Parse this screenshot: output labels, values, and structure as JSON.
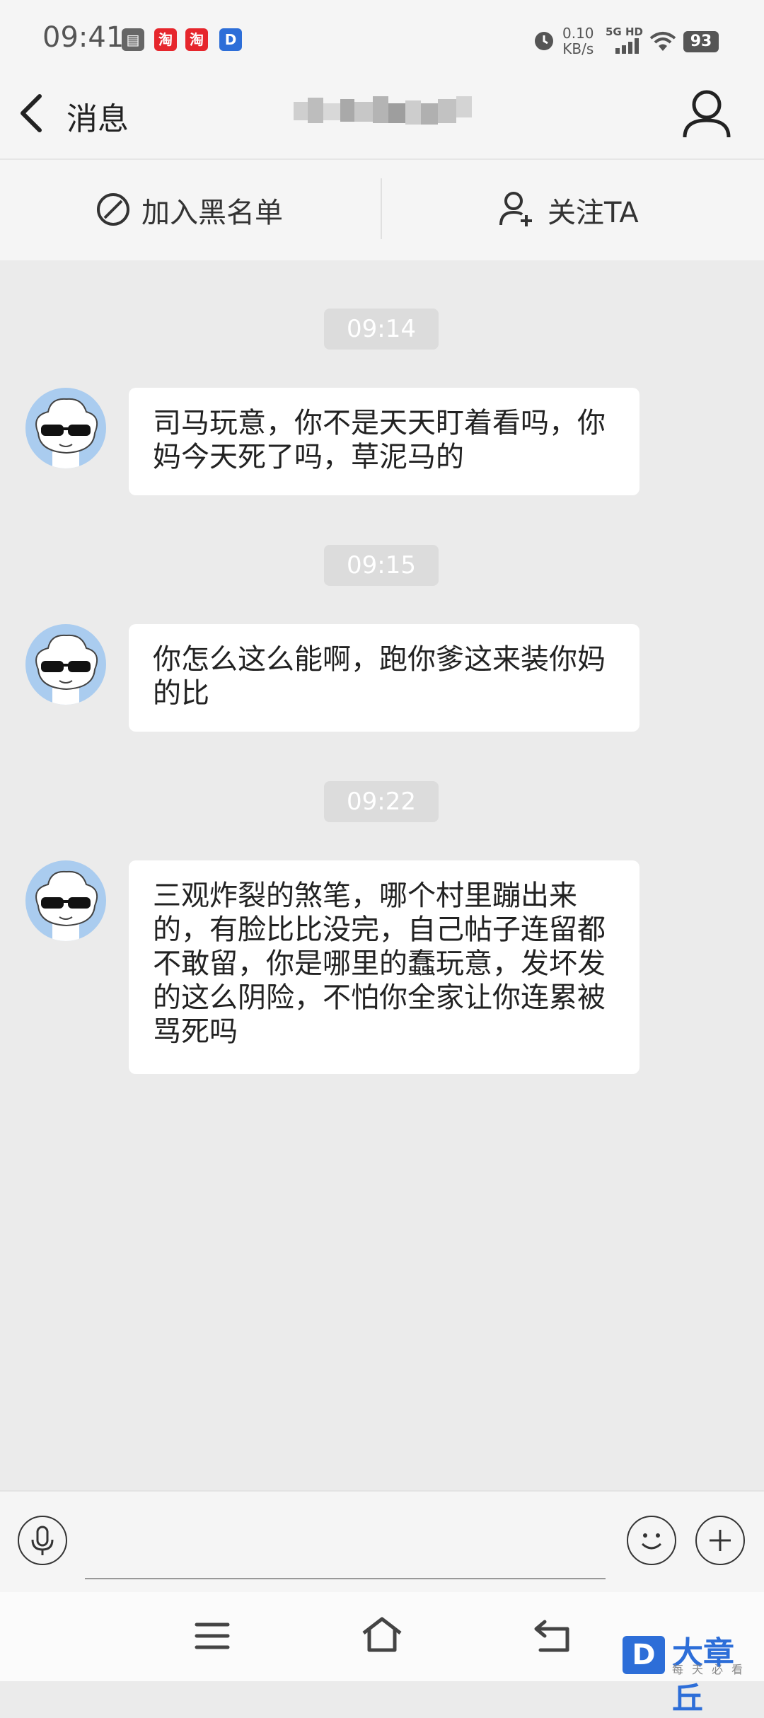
{
  "status_bar": {
    "time": "09:41",
    "app_icons": [
      {
        "name": "sim-card-icon",
        "glyph": "▤",
        "color": "#666666"
      },
      {
        "name": "taobao-icon",
        "glyph": "淘",
        "color": "#e6262c"
      },
      {
        "name": "taobao-icon-2",
        "glyph": "淘",
        "color": "#e6262c"
      },
      {
        "name": "dazhangqiu-icon",
        "glyph": "D",
        "color": "#2d6ed8"
      }
    ],
    "net_rate_value": "0.10",
    "net_rate_unit": "KB/s",
    "network_label": "5G HD",
    "battery": "93"
  },
  "nav": {
    "back_label": "消息"
  },
  "actions": {
    "blacklist_label": "加入黑名单",
    "follow_label": "关注TA"
  },
  "messages": [
    {
      "time": "09:14",
      "text": "司马玩意，你不是天天盯着看吗，你妈今天死了吗，草泥马的"
    },
    {
      "time": "09:15",
      "text": "你怎么这么能啊，跑你爹这来装你妈的比"
    },
    {
      "time": "09:22",
      "text": "三观炸裂的煞笔，哪个村里蹦出来的，有脸比比没完，自己帖子连留都不敢留，你是哪里的蠢玩意，发坏发的这么阴险，不怕你全家让你连累被骂死吗"
    }
  ],
  "input": {
    "placeholder": ""
  },
  "watermark": {
    "logo_letter": "D",
    "name": "大章丘",
    "slogan": "每天必看"
  },
  "colors": {
    "chat_background": "#ebebeb",
    "bar_background": "#f5f5f5",
    "avatar_background": "#aaccef",
    "brand_blue": "#2d6ed8"
  }
}
